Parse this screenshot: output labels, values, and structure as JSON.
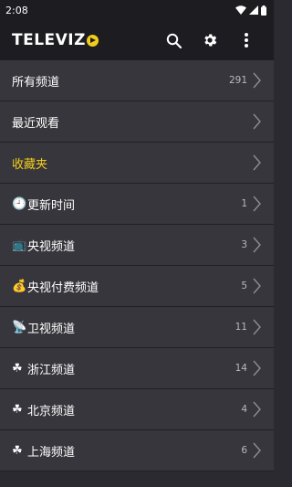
{
  "status_bar": {
    "time": "2:08"
  },
  "app_bar": {
    "logo_text_main": "TELEVIZ",
    "icons": [
      "search-icon",
      "gear-icon",
      "more-vertical-icon"
    ]
  },
  "colors": {
    "accent": "#f1cd1b",
    "background": "#2b2a30",
    "row": "#37363c",
    "bar": "#1c1c21"
  },
  "list": [
    {
      "icon": "",
      "label": "所有频道",
      "count": "291",
      "highlight": false
    },
    {
      "icon": "",
      "label": "最近观看",
      "count": "",
      "highlight": false
    },
    {
      "icon": "",
      "label": "收藏夹",
      "count": "",
      "highlight": true
    },
    {
      "icon": "🕘",
      "label": "更新时间",
      "count": "1",
      "highlight": false
    },
    {
      "icon": "📺",
      "label": "央视频道",
      "count": "3",
      "highlight": false
    },
    {
      "icon": "💰",
      "label": "央视付费频道",
      "count": "5",
      "highlight": false
    },
    {
      "icon": "📡",
      "label": "卫视频道",
      "count": "11",
      "highlight": false
    },
    {
      "icon": "☘",
      "label": "浙江频道",
      "count": "14",
      "highlight": false
    },
    {
      "icon": "☘",
      "label": "北京频道",
      "count": "4",
      "highlight": false
    },
    {
      "icon": "☘",
      "label": "上海频道",
      "count": "6",
      "highlight": false
    }
  ]
}
